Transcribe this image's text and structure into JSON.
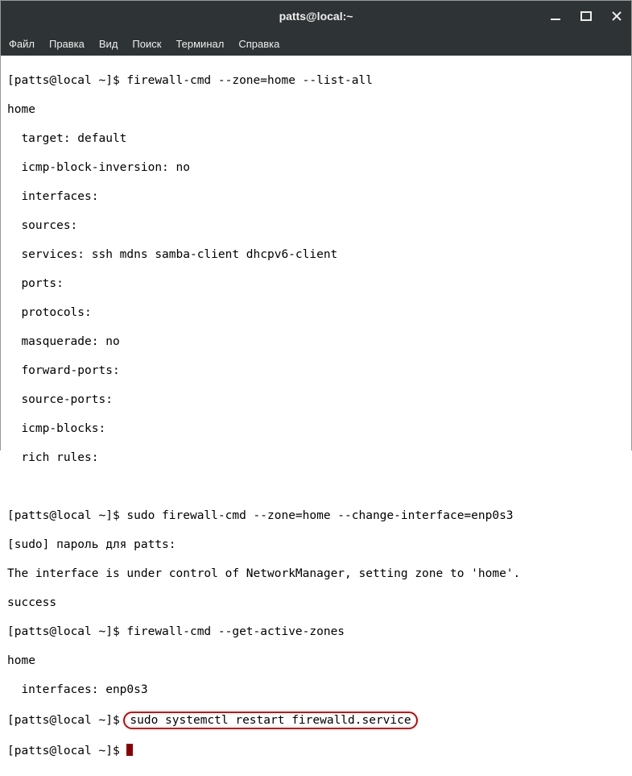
{
  "window": {
    "title": "patts@local:~"
  },
  "menubar": {
    "file": "Файл",
    "edit": "Правка",
    "view": "Вид",
    "search": "Поиск",
    "terminal": "Терминал",
    "help": "Справка"
  },
  "prompt": "[patts@local ~]$ ",
  "term": {
    "cmd1": "firewall-cmd --zone=home --list-all",
    "out1_home": "home",
    "out1_target": "target: default",
    "out1_icmpinv": "icmp-block-inversion: no",
    "out1_interfaces": "interfaces:",
    "out1_sources": "sources:",
    "out1_services": "services: ssh mdns samba-client dhcpv6-client",
    "out1_ports": "ports:",
    "out1_protocols": "protocols:",
    "out1_masquerade": "masquerade: no",
    "out1_fwdports": "forward-ports:",
    "out1_srcports": "source-ports:",
    "out1_icmpblocks": "icmp-blocks:",
    "out1_rich": "rich rules:",
    "cmd2": "sudo firewall-cmd --zone=home --change-interface=enp0s3",
    "out2_sudo": "[sudo] пароль для patts:",
    "out2_msg": "The interface is under control of NetworkManager, setting zone to 'home'.",
    "out2_success": "success",
    "cmd3": "firewall-cmd --get-active-zones",
    "out3_home": "home",
    "out3_if": "interfaces: enp0s3",
    "cmd4": "sudo systemctl restart firewalld.service"
  }
}
